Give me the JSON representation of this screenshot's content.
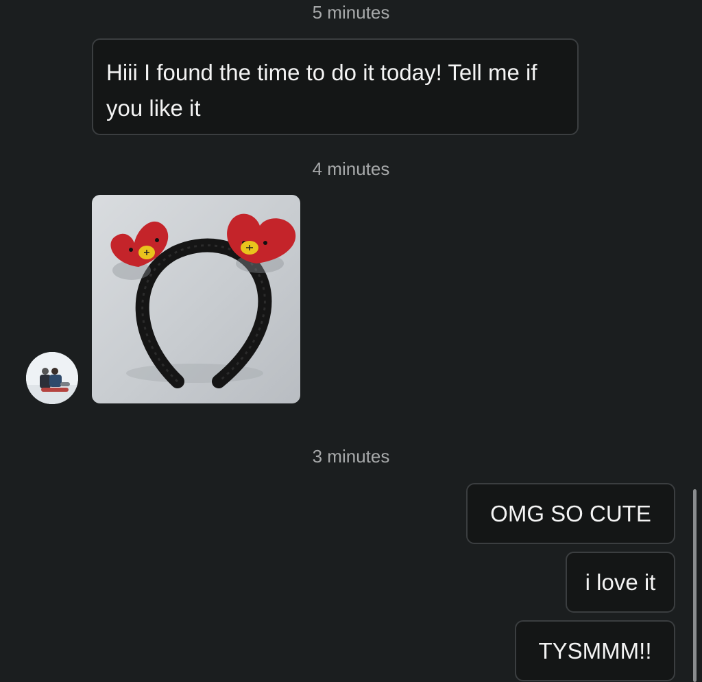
{
  "conversation": {
    "timestamps": [
      "5 minutes",
      "4 minutes",
      "3 minutes"
    ],
    "incoming_message": "Hiii I found the time to do it today! Tell me if you like it",
    "outgoing_messages": [
      "OMG SO CUTE",
      "i love it",
      "TYSMMM!!"
    ]
  },
  "photo": {
    "subject": "crocheted-heart-headband",
    "colors": {
      "background": "#d3d6d9",
      "heart": "#c8262b",
      "nose": "#e9c41d",
      "band": "#1a1a1a"
    }
  },
  "theme": {
    "background": "#1b1e1f",
    "bubble_fill": "#141616",
    "bubble_border": "#3b3e40",
    "timestamp_color": "#a7a9aa",
    "text_color": "#f4f4f4"
  }
}
